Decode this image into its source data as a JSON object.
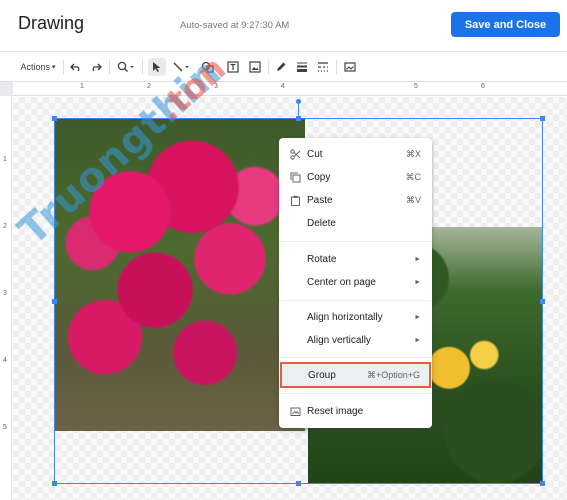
{
  "header": {
    "title": "Drawing",
    "autosave": "Auto-saved at 9:27:30 AM",
    "save_close": "Save and Close"
  },
  "toolbar": {
    "actions": "Actions",
    "actions_caret": "▾",
    "icons": [
      "undo-icon",
      "redo-icon",
      "zoom-icon",
      "select-icon",
      "line-icon",
      "shape-icon",
      "textbox-icon",
      "image-icon",
      "pen-icon",
      "border-weight-icon",
      "border-dash-icon",
      "replace-image-icon"
    ]
  },
  "ruler": {
    "top_numbers": [
      "1",
      "2",
      "3",
      "4",
      "5",
      "6"
    ],
    "left_numbers": [
      "1",
      "2",
      "3",
      "4",
      "5"
    ]
  },
  "watermark": {
    "part1": "Truongthin",
    "part2": ".ton"
  },
  "context_menu": {
    "items": [
      {
        "icon": "scissors-icon",
        "label": "Cut",
        "shortcut": "⌘X"
      },
      {
        "icon": "copy-icon",
        "label": "Copy",
        "shortcut": "⌘C"
      },
      {
        "icon": "paste-icon",
        "label": "Paste",
        "shortcut": "⌘V"
      },
      {
        "label": "Delete"
      },
      {
        "label": "Rotate",
        "submenu": "►"
      },
      {
        "label": "Center on page",
        "submenu": "►"
      },
      {
        "label": "Align horizontally",
        "submenu": "►"
      },
      {
        "label": "Align vertically",
        "submenu": "►"
      },
      {
        "label": "Group",
        "shortcut": "⌘+Option+G",
        "highlighted": true
      },
      {
        "icon": "reset-image-icon",
        "label": "Reset image"
      }
    ]
  },
  "colors": {
    "accent": "#1a73e8",
    "selection": "#4285f4",
    "highlight_border": "#e06040"
  }
}
